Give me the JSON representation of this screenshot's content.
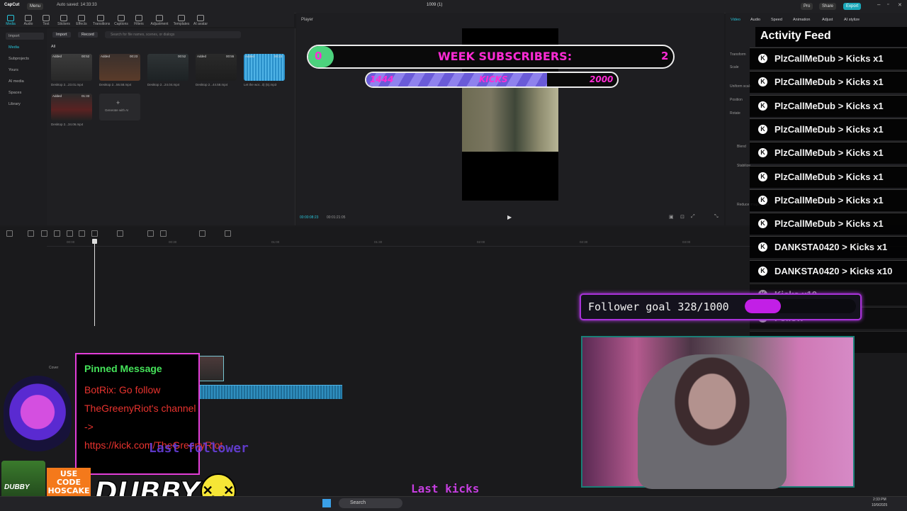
{
  "window": {
    "app_name": "CapCut",
    "menu_label": "Menu",
    "autosave": "Auto saved: 14:33:33",
    "project_title": "1009 (1)",
    "pro_label": "Pro",
    "share_label": "Share",
    "export_label": "Export"
  },
  "toolbar": {
    "tabs": [
      "Media",
      "Audio",
      "Text",
      "Stickers",
      "Effects",
      "Transitions",
      "Captions",
      "Filters",
      "Adjustment",
      "Templates",
      "AI avatar"
    ]
  },
  "left_nav": {
    "items": [
      "Import",
      "Media",
      "Subprojects",
      "Yours",
      "AI media",
      "Spaces",
      "Library"
    ]
  },
  "media": {
    "import_label": "Import",
    "record_label": "Record",
    "search_placeholder": "Search for file names, scenes, or dialogs",
    "filter_all": "All",
    "clips": [
      {
        "badge": "Added",
        "duration": "00:52",
        "name": "Desktop 2...23.01.mp4"
      },
      {
        "badge": "Added",
        "duration": "00:23",
        "name": "Desktop 2...56.58.mp4"
      },
      {
        "badge": "",
        "duration": "00:52",
        "name": "Desktop 2...24.04.mp4"
      },
      {
        "badge": "Added",
        "duration": "00:55",
        "name": "Desktop 2...44.58.mp4"
      },
      {
        "badge": "Added",
        "duration": "00:23",
        "name": "Let the wor...it) (5).mp3"
      },
      {
        "badge": "Added",
        "duration": "01:33",
        "name": "Desktop 2...34.06.mp4"
      }
    ],
    "generate_label": "Generate with AI"
  },
  "player": {
    "title": "Player",
    "current_time": "00:00:08:23",
    "total_time": "00:01:21:05"
  },
  "properties": {
    "tabs": [
      "Video",
      "Audio",
      "Speed",
      "Animation",
      "Adjust",
      "AI stylize"
    ],
    "rows": [
      "Transform",
      "Scale",
      "Uniform scale",
      "Position",
      "Rotate",
      "Blend",
      "Stabilize",
      "Reduce image noise"
    ]
  },
  "timeline": {
    "ticks": [
      "00:00",
      "00:30",
      "01:00",
      "01:30",
      "02:00",
      "02:30",
      "03:00"
    ],
    "cover_label": "Cover"
  },
  "overlay": {
    "sub_goal": {
      "current": "0",
      "label": "WEEK SUBSCRIBERS:",
      "target": "2"
    },
    "kicks_goal": {
      "current": "1444",
      "label": "KICKS",
      "target": "2000",
      "progress": 0.72
    },
    "activity_feed": {
      "title": "Activity Feed",
      "rows": [
        {
          "user": "PlzCallMeDub",
          "action": "Kicks x1"
        },
        {
          "user": "PlzCallMeDub",
          "action": "Kicks x1"
        },
        {
          "user": "PlzCallMeDub",
          "action": "Kicks x1"
        },
        {
          "user": "PlzCallMeDub",
          "action": "Kicks x1"
        },
        {
          "user": "PlzCallMeDub",
          "action": "Kicks x1"
        },
        {
          "user": "PlzCallMeDub",
          "action": "Kicks x1"
        },
        {
          "user": "PlzCallMeDub",
          "action": "Kicks x1"
        },
        {
          "user": "PlzCallMeDub",
          "action": "Kicks x1"
        },
        {
          "user": "DANKSTA0420",
          "action": "Kicks x1"
        },
        {
          "user": "DANKSTA0420",
          "action": "Kicks x10"
        },
        {
          "user": "",
          "action": "Kicks x10"
        },
        {
          "user": "",
          "action": "Follow"
        },
        {
          "user": "",
          "action": "ollow"
        }
      ]
    },
    "follower_goal": {
      "text": "Follower goal 328/1000",
      "progress": 0.328
    },
    "pinned": {
      "title": "Pinned Message",
      "body": "BotRix: Go follow TheGreenyRiot's channel -> https://kick.com/TheGreenyRiot"
    },
    "last_follower_label": "Last follower",
    "last_kicks_label": "Last kicks",
    "sponsor": {
      "brand": "DUBBY",
      "code_line1": "USE",
      "code_line2": "CODE",
      "code_line3": "HOSCAKE",
      "can_label": "DUBBY"
    }
  },
  "taskbar": {
    "search_label": "Search",
    "time": "2:33 PM",
    "date": "10/9/2025"
  }
}
